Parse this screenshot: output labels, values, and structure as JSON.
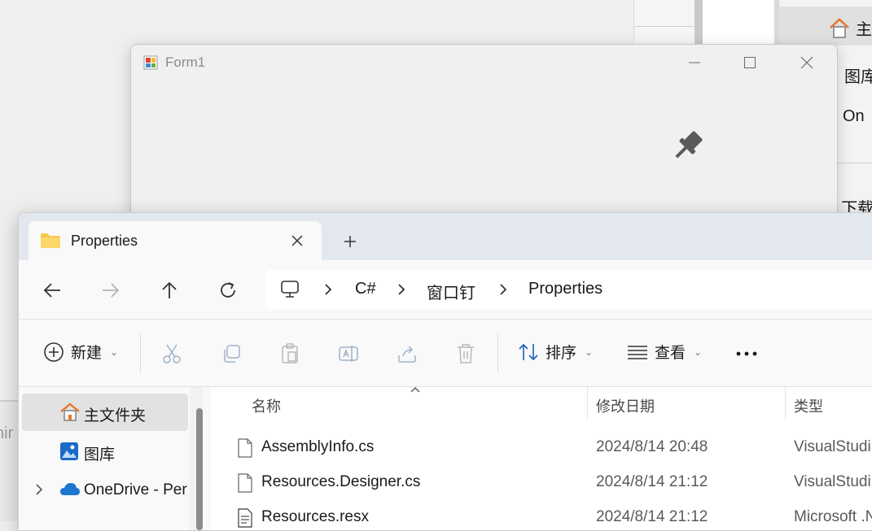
{
  "background": {
    "explorer_nav": [
      "主文",
      "图库",
      "On",
      "下载"
    ],
    "left_chip_text": "nir"
  },
  "form1": {
    "title": "Form1"
  },
  "explorer": {
    "tab": {
      "title": "Properties"
    },
    "breadcrumb": [
      "C#",
      "窗口钉",
      "Properties"
    ],
    "commands": {
      "new_label": "新建",
      "sort_label": "排序",
      "view_label": "查看"
    },
    "nav_pane": {
      "items": [
        {
          "label": "主文件夹",
          "icon": "home-icon"
        },
        {
          "label": "图库",
          "icon": "gallery-icon"
        },
        {
          "label": "OneDrive - Per",
          "icon": "onedrive-icon"
        }
      ]
    },
    "columns": [
      "名称",
      "修改日期",
      "类型"
    ],
    "files": [
      {
        "name": "AssemblyInfo.cs",
        "modified": "2024/8/14 20:48",
        "type": "VisualStudi"
      },
      {
        "name": "Resources.Designer.cs",
        "modified": "2024/8/14 21:12",
        "type": "VisualStudi"
      },
      {
        "name": "Resources.resx",
        "modified": "2024/8/14 21:12",
        "type": "Microsoft .N"
      }
    ]
  },
  "colors": {
    "folder": "#f6c84a",
    "home_orange": "#e8742b",
    "onedrive_blue": "#1b76d1",
    "tabstrip_bg": "#e3e8ee"
  }
}
